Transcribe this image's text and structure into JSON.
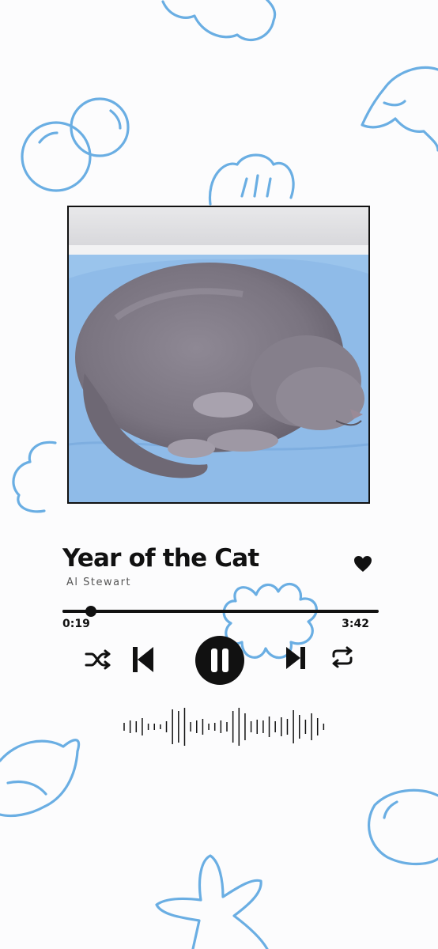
{
  "track": {
    "title": "Year of the Cat",
    "artist": "Al Stewart",
    "liked": true
  },
  "progress": {
    "current_time": "0:19",
    "total_time": "3:42",
    "fraction": 0.09
  },
  "controls": {
    "shuffle_icon": "shuffle-icon",
    "previous_icon": "skip-previous-icon",
    "play_pause_icon": "pause-icon",
    "next_icon": "skip-next-icon",
    "repeat_icon": "repeat-icon",
    "like_icon": "heart-icon"
  },
  "colors": {
    "accent": "#111111",
    "doodle": "#6aaee3",
    "background": "#fcfcfd"
  }
}
